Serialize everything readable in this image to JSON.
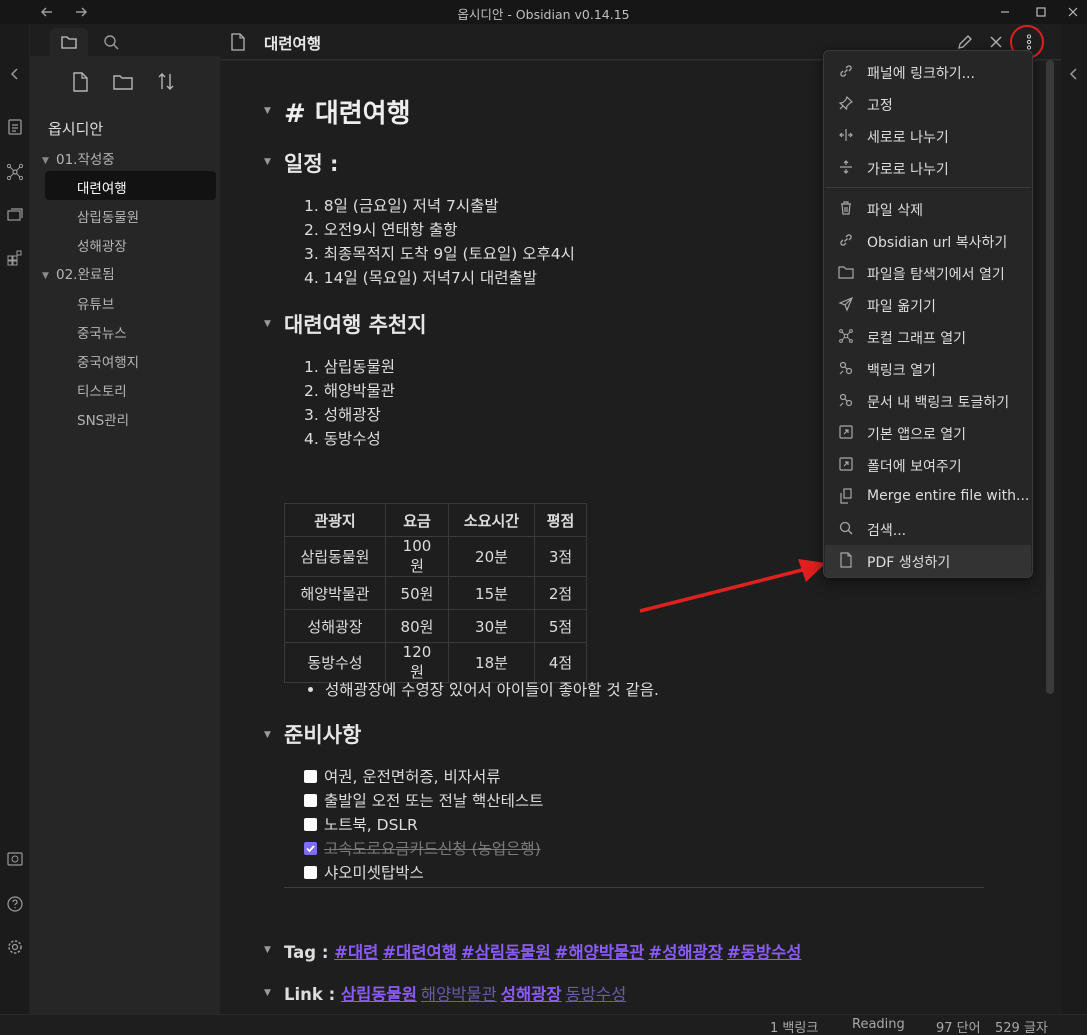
{
  "window": {
    "title": "옵시디안 - Obsidian v0.14.15"
  },
  "sidebar": {
    "vault_name": "옵시디안",
    "folders": [
      {
        "name": "01.작성중",
        "files": [
          "대련여행",
          "삼립동물원",
          "성해광장"
        ]
      },
      {
        "name": "02.완료됨",
        "files": [
          "유튜브",
          "중국뉴스",
          "중국여행지",
          "티스토리",
          "SNS관리"
        ]
      }
    ],
    "active_file": "대련여행"
  },
  "editor": {
    "tab_title": "대련여행",
    "h1": "# 대련여행",
    "schedule": {
      "heading": "일정 :",
      "items": [
        "8일 (금요일) 저녁 7시출발",
        "오전9시 연태항 출항",
        "최종목적지 도착 9일 (토요일) 오후4시",
        "14일 (목요일) 저녁7시 대련출발"
      ]
    },
    "recommend": {
      "heading": "대련여행 추천지",
      "items": [
        "삼립동물원",
        "해양박물관",
        "성해광장",
        "동방수성"
      ],
      "table": {
        "headers": [
          "관광지",
          "요금",
          "소요시간",
          "평점"
        ],
        "rows": [
          [
            "삼립동물원",
            "100원",
            "20분",
            "3점"
          ],
          [
            "해양박물관",
            "50원",
            "15분",
            "2점"
          ],
          [
            "성해광장",
            "80원",
            "30분",
            "5점"
          ],
          [
            "동방수성",
            "120원",
            "18분",
            "4점"
          ]
        ]
      },
      "note": "성해광장에 수영장 있어서 아이들이 좋아할 것 같음."
    },
    "prep": {
      "heading": "준비사항",
      "tasks": [
        {
          "text": "여권, 운전면허증, 비자서류",
          "done": false
        },
        {
          "text": "출발일 오전 또는 전날 핵산테스트",
          "done": false
        },
        {
          "text": "노트북, DSLR",
          "done": false
        },
        {
          "text": "고속도로요금카드신청 (농업은행)",
          "done": true
        },
        {
          "text": "샤오미셋탑박스",
          "done": false
        }
      ]
    },
    "tag_label": "Tag :",
    "tags": [
      "#대련",
      "#대련여행",
      "#삼림동물원",
      "#해양박물관",
      "#성해광장",
      "#동방수성"
    ],
    "link_label": "Link :",
    "links": [
      {
        "text": "삼립동물원",
        "resolved": true
      },
      {
        "text": "해양박물관",
        "resolved": false
      },
      {
        "text": "성해광장",
        "resolved": true
      },
      {
        "text": "동방수성",
        "resolved": false
      }
    ]
  },
  "menu": {
    "items": [
      "패널에 링크하기...",
      "고정",
      "세로로 나누기",
      "가로로 나누기",
      "파일 삭제",
      "Obsidian url 복사하기",
      "파일을 탐색기에서 열기",
      "파일 옮기기",
      "로컬 그래프 열기",
      "백링크 열기",
      "문서 내 백링크 토글하기",
      "기본 앱으로 열기",
      "폴더에 보여주기",
      "Merge entire file with...",
      "검색...",
      "PDF 생성하기"
    ],
    "highlighted": "PDF 생성하기"
  },
  "status": {
    "backlinks": "1 백링크",
    "mode": "Reading",
    "words": "97 단어",
    "chars": "529 글자"
  },
  "colors": {
    "accent": "#7f6df2",
    "link": "#8a5cf5",
    "annotation": "#e0201f"
  }
}
